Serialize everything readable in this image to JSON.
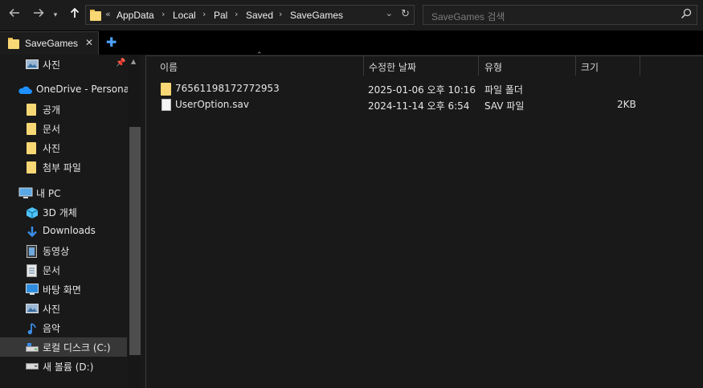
{
  "address_bar": {
    "overflow": "«",
    "crumbs": [
      "AppData",
      "Local",
      "Pal",
      "Saved",
      "SaveGames"
    ]
  },
  "search": {
    "placeholder": "SaveGames 검색"
  },
  "tab": {
    "label": "SaveGames"
  },
  "nav": {
    "items": [
      {
        "label": "사진",
        "icon": "pictures-icon"
      },
      {
        "label": "OneDrive - Personal",
        "icon": "onedrive-cloud-icon"
      },
      {
        "label": "공개",
        "icon": "folder-icon"
      },
      {
        "label": "문서",
        "icon": "folder-icon"
      },
      {
        "label": "사진",
        "icon": "folder-icon"
      },
      {
        "label": "첨부 파일",
        "icon": "folder-icon"
      },
      {
        "label": "내 PC",
        "icon": "this-pc-icon"
      },
      {
        "label": "3D 개체",
        "icon": "3d-objects-icon"
      },
      {
        "label": "Downloads",
        "icon": "downloads-icon"
      },
      {
        "label": "동영상",
        "icon": "videos-icon"
      },
      {
        "label": "문서",
        "icon": "documents-icon"
      },
      {
        "label": "바탕 화면",
        "icon": "desktop-icon"
      },
      {
        "label": "사진",
        "icon": "pictures-icon"
      },
      {
        "label": "음악",
        "icon": "music-icon"
      },
      {
        "label": "로컬 디스크 (C:)",
        "icon": "local-disk-icon"
      },
      {
        "label": "새 볼륨 (D:)",
        "icon": "drive-icon"
      }
    ]
  },
  "columns": [
    "이름",
    "수정한 날짜",
    "유형",
    "크기"
  ],
  "files": [
    {
      "name": "76561198172772953",
      "modified": "2025-01-06 오후 10:16",
      "type": "파일 폴더",
      "size": "",
      "icon": "folder-icon"
    },
    {
      "name": "UserOption.sav",
      "modified": "2024-11-14 오후 6:54",
      "type": "SAV 파일",
      "size": "2KB",
      "icon": "file-icon"
    }
  ],
  "colors": {
    "background": "#191919",
    "folder": "#f8d775",
    "accent": "#4ea1ff",
    "selected": "#373737"
  }
}
